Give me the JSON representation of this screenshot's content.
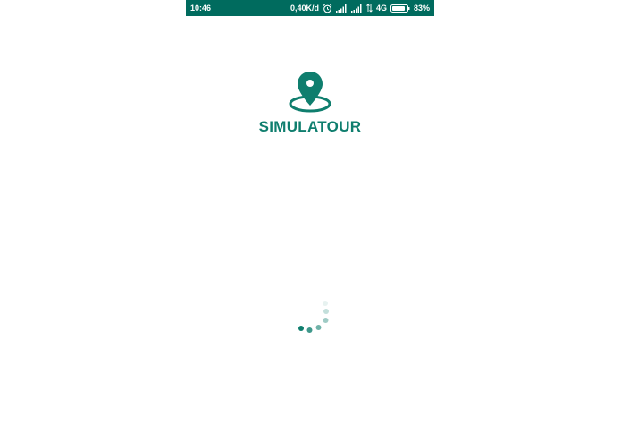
{
  "status_bar": {
    "time": "10:46",
    "network_speed": "0,40K/d",
    "network_type": "4G",
    "battery": "83%",
    "icons": [
      "alarm-icon",
      "signal-icon",
      "signal-icon",
      "data-arrows-icon",
      "battery-icon"
    ]
  },
  "app": {
    "name": "SIMULATOUR",
    "logo_icon": "map-pin-icon",
    "brand_color": "#0f7e6e"
  },
  "loading": {
    "indicator": "dotted-spinner-icon"
  },
  "colors": {
    "status_bar": "#006b5e",
    "accent": "#0f7e6e",
    "background": "#ffffff"
  }
}
